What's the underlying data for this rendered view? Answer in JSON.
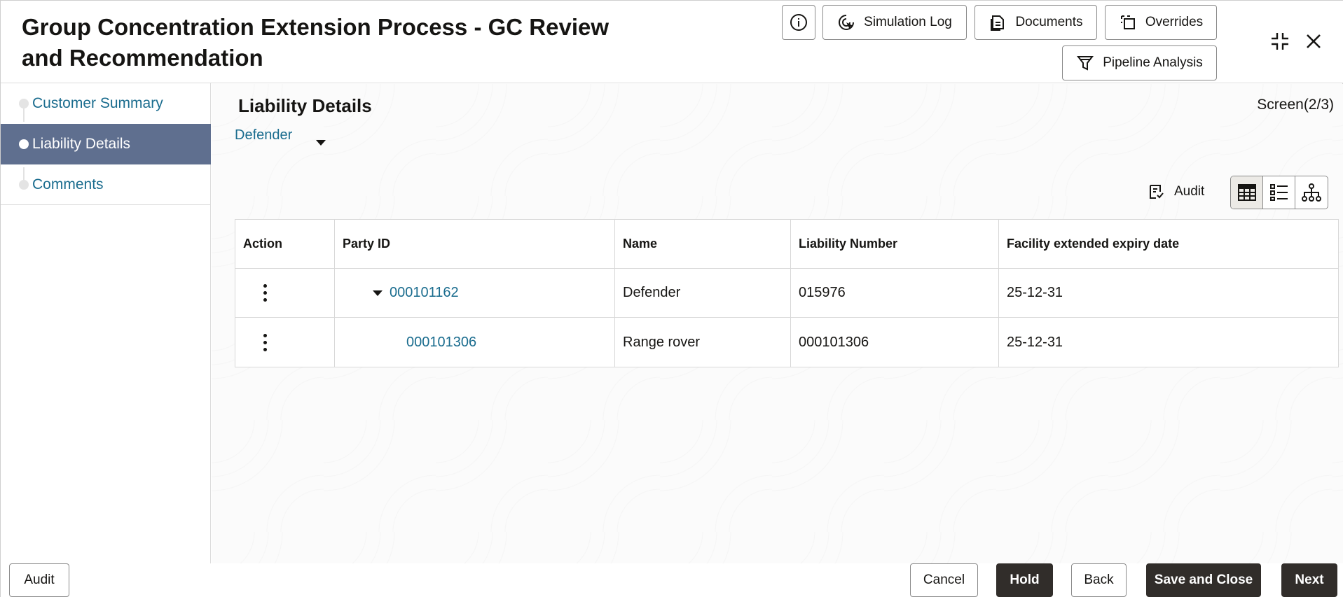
{
  "header": {
    "title": "Group Concentration Extension Process - GC Review and Recommendation",
    "buttons": {
      "simulation_log": "Simulation Log",
      "documents": "Documents",
      "overrides": "Overrides",
      "pipeline_analysis": "Pipeline Analysis"
    },
    "icons": [
      "info-icon",
      "simulation-icon",
      "documents-icon",
      "overrides-icon",
      "funnel-icon",
      "minimize-icon",
      "close-icon"
    ]
  },
  "sidebar": {
    "items": [
      {
        "label": "Customer Summary",
        "active": false
      },
      {
        "label": "Liability Details",
        "active": true
      },
      {
        "label": "Comments",
        "active": false
      }
    ]
  },
  "main": {
    "section_title": "Liability Details",
    "screen_indicator": "Screen(2/3)",
    "selector_value": "Defender",
    "audit_label": "Audit",
    "view_modes": [
      "table-view-icon",
      "list-view-icon",
      "hierarchy-view-icon"
    ],
    "table": {
      "columns": [
        "Action",
        "Party ID",
        "Name",
        "Liability Number",
        "Facility extended expiry date"
      ],
      "rows": [
        {
          "party_id": "000101162",
          "name": "Defender",
          "liability_number": "015976",
          "expiry": "25-12-31",
          "expanded": true
        },
        {
          "party_id": "000101306",
          "name": "Range rover",
          "liability_number": "000101306",
          "expiry": "25-12-31",
          "expanded": false
        }
      ]
    }
  },
  "footer": {
    "audit": "Audit",
    "cancel": "Cancel",
    "hold": "Hold",
    "back": "Back",
    "save_close": "Save and Close",
    "next": "Next"
  },
  "colors": {
    "accent_link": "#1a6c8e",
    "active_nav_bg": "#5f6f8f",
    "primary_button": "#312d2a"
  }
}
